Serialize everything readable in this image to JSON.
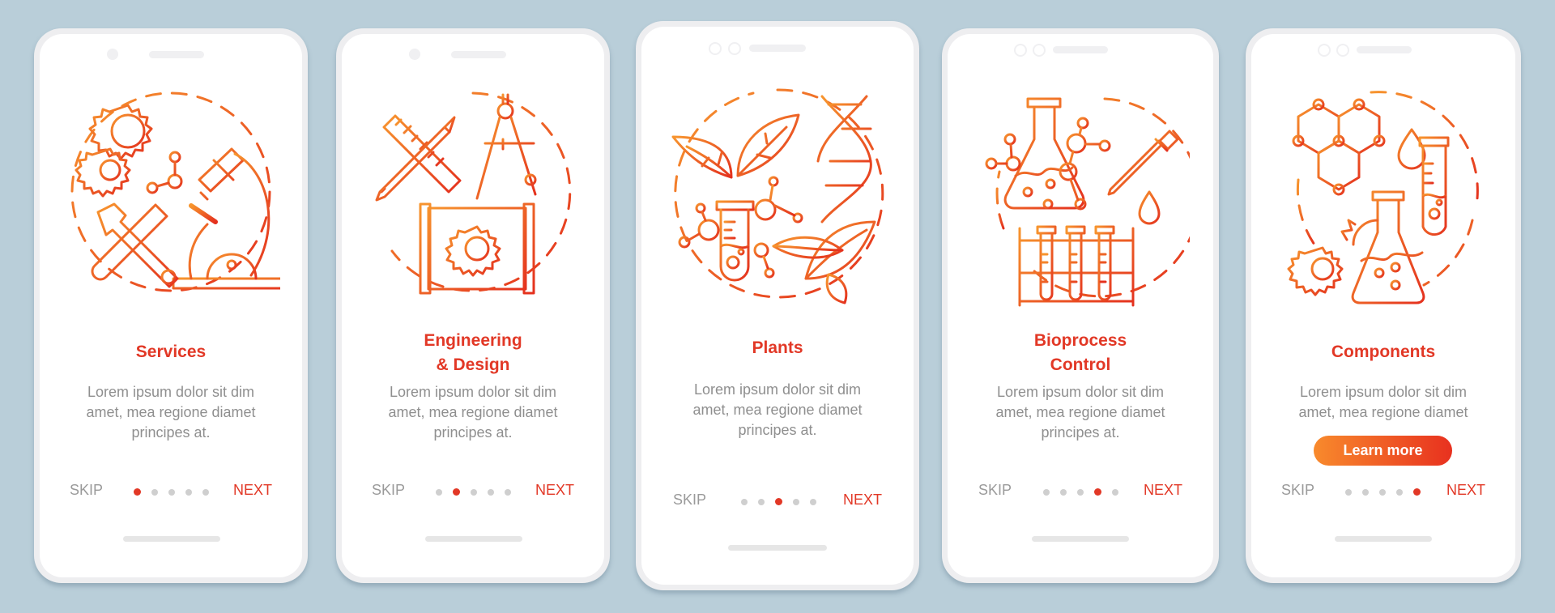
{
  "colors": {
    "background": "#b9ced9",
    "accent": "#e23826",
    "gradient_start": "#f7902c",
    "gradient_end": "#e5301e",
    "text_gray": "#8f8f8f"
  },
  "screens": [
    {
      "title_lines": [
        "Services"
      ],
      "body_lines": [
        "Lorem ipsum dolor sit dim",
        "amet, mea regione diamet",
        "principes at."
      ],
      "skip": "SKIP",
      "next": "NEXT",
      "active_dot": 1,
      "icon": "services-illustration-icon"
    },
    {
      "title_lines": [
        "Engineering",
        "& Design"
      ],
      "body_lines": [
        "Lorem ipsum dolor sit dim",
        "amet, mea regione diamet",
        "principes at."
      ],
      "skip": "SKIP",
      "next": "NEXT",
      "active_dot": 2,
      "icon": "engineering-illustration-icon"
    },
    {
      "title_lines": [
        "Plants"
      ],
      "body_lines": [
        "Lorem ipsum dolor sit dim",
        "amet, mea regione diamet",
        "principes at."
      ],
      "skip": "SKIP",
      "next": "NEXT",
      "active_dot": 3,
      "icon": "plants-illustration-icon"
    },
    {
      "title_lines": [
        "Bioprocess",
        "Control"
      ],
      "body_lines": [
        "Lorem ipsum dolor sit dim",
        "amet, mea regione diamet",
        "principes at."
      ],
      "skip": "SKIP",
      "next": "NEXT",
      "active_dot": 4,
      "icon": "bioprocess-illustration-icon"
    },
    {
      "title_lines": [
        "Components"
      ],
      "body_lines": [
        "Lorem ipsum dolor sit dim",
        "amet, mea regione diamet"
      ],
      "button": "Learn more",
      "skip": "SKIP",
      "next": "NEXT",
      "active_dot": 5,
      "icon": "components-illustration-icon"
    }
  ],
  "pagination": {
    "total_dots": 5
  }
}
